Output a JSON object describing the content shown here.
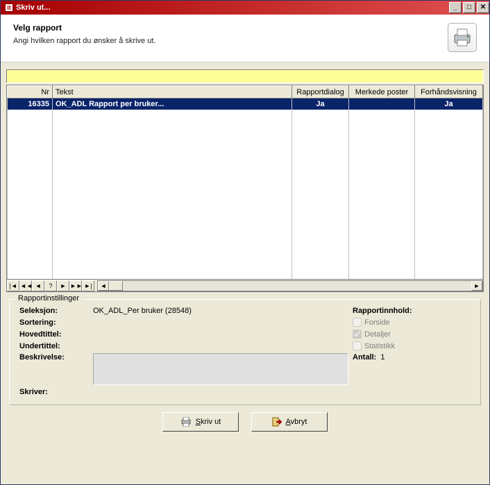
{
  "window": {
    "title": "Skriv ut..."
  },
  "header": {
    "title": "Velg rapport",
    "subtitle": "Angi hvilken rapport du ønsker å skrive ut."
  },
  "grid": {
    "columns": {
      "nr": "Nr",
      "tekst": "Tekst",
      "rapportdialog": "Rapportdialog",
      "merkede": "Merkede poster",
      "forhand": "Forhåndsvisning"
    },
    "rows": [
      {
        "nr": "16335",
        "tekst": "OK_ADL Rapport per bruker...",
        "rapportdialog": "Ja",
        "merkede": "",
        "forhand": "Ja"
      }
    ]
  },
  "nav": {
    "first": "|◄",
    "prevpage": "◄◄",
    "prev": "◄",
    "help": "?",
    "next": "►",
    "nextpage": "►►",
    "last": "►|",
    "scroll_left": "◄",
    "scroll_right": "►"
  },
  "settings": {
    "legend": "Rapportinstillinger",
    "labels": {
      "seleksjon": "Seleksjon:",
      "sortering": "Sortering:",
      "hovedtittel": "Hovedtittel:",
      "undertittel": "Undertittel:",
      "beskrivelse": "Beskrivelse:",
      "skriver": "Skriver:"
    },
    "seleksjon_value": "OK_ADL_Per bruker (28548)",
    "sortering_value": "",
    "hovedtittel_value": "",
    "undertittel_value": "",
    "skriver_value": "",
    "rapportinnhold": {
      "title": "Rapportinnhold:",
      "forside": "Forside",
      "detaljer": "Detaljer",
      "statistikk": "Statistikk",
      "antall_label": "Antall:",
      "antall_value": "1"
    }
  },
  "buttons": {
    "skriv_ut_prefix": "S",
    "skriv_ut_rest": "kriv ut",
    "avbryt_prefix": "A",
    "avbryt_rest": "vbryt"
  }
}
